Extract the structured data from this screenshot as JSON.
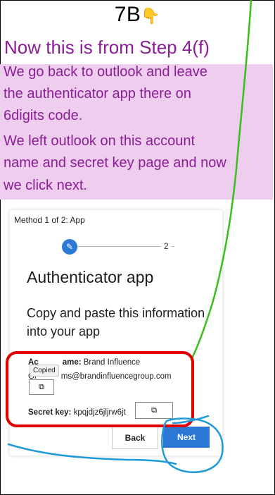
{
  "header": {
    "title": "7B"
  },
  "annotation": {
    "step_heading": "Now this is from Step 4(f)",
    "note_lines": [
      "We go back to outlook and leave",
      "the authenticator app there on",
      "6digits code.",
      "We left outlook on this account",
      "name and secret key page and now",
      "we click next."
    ]
  },
  "card": {
    "method_label": "Method 1 of 2: App",
    "step_current_icon": "pencil-icon",
    "step_next": "2",
    "title": "Authenticator app",
    "instruction": "Copy and paste this information into your app",
    "account_label_visible": "Ac",
    "account_label_rest": "ame:",
    "account_value": "Brand Influence",
    "email_prefix": "Gr",
    "email_suffix": "ms@brandinfluencegroup.com",
    "copied_tooltip": "Copied",
    "secret_label": "Secret key:",
    "secret_value": "kpqjdjz6jljrw6jt",
    "back_label": "Back",
    "next_label": "Next"
  },
  "colors": {
    "heading": "#8b1e96",
    "note_bg": "#eecdee",
    "primary": "#2b78d6",
    "highlight_red": "#e00000",
    "arrow_green": "#3bbf1f",
    "circle_blue": "#1f9ad6"
  }
}
